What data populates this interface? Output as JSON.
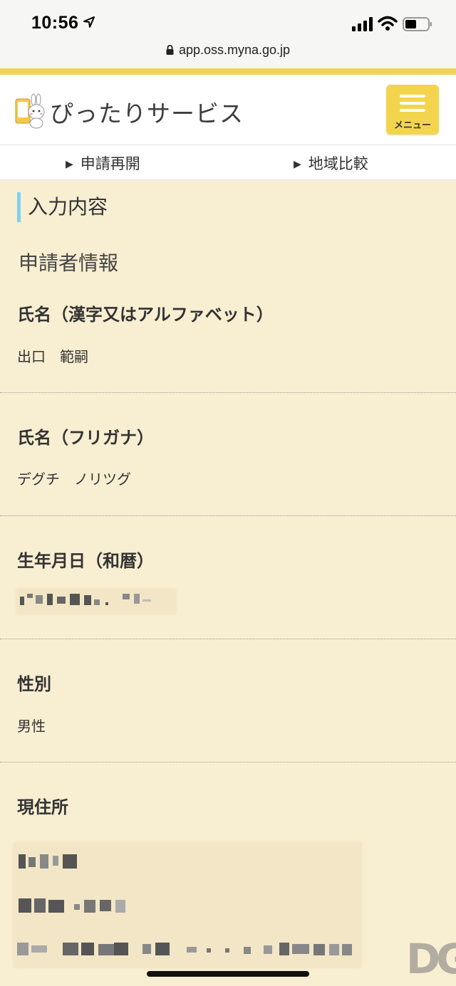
{
  "status_bar": {
    "time": "10:56"
  },
  "browser": {
    "url": "app.oss.myna.go.jp"
  },
  "header": {
    "brand": "ぴったりサービス",
    "menu_label": "メニュー"
  },
  "subnav": [
    {
      "label": "申請再開"
    },
    {
      "label": "地域比較"
    }
  ],
  "section_title": "入力内容",
  "subheading": "申請者情報",
  "fields": [
    {
      "label": "氏名（漢字又はアルファベット）",
      "value": "出口　範嗣"
    },
    {
      "label": "氏名（フリガナ）",
      "value": "デグチ　ノリツグ"
    },
    {
      "label": "生年月日（和暦）",
      "value": ""
    },
    {
      "label": "性別",
      "value": "男性"
    },
    {
      "label": "現住所",
      "value": ""
    }
  ],
  "watermark": "DG",
  "colors": {
    "page_bg": "#f8eed2",
    "accent_yellow": "#f3d54d",
    "title_bar": "#7fd1ec"
  }
}
